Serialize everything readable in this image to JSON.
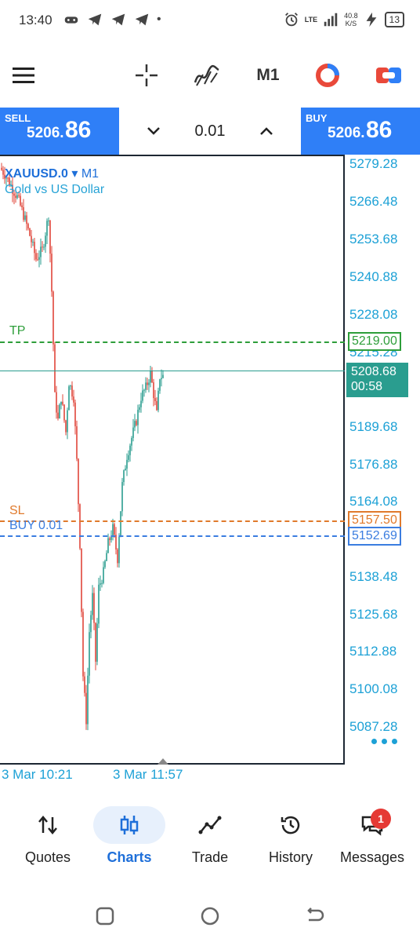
{
  "status_bar": {
    "time": "13:40",
    "dot": "•",
    "network": "LTE",
    "net_speed_value": "40.8",
    "net_speed_unit": "K/S",
    "battery": "13"
  },
  "toolbar": {
    "menu_icon": "hamburger-menu-icon",
    "crosshair_icon": "crosshair-icon",
    "indicators_icon": "indicators-icon",
    "timeframe": "M1",
    "objects_icon": "objects-icon",
    "trade_toggle_icon": "one-click-trading-icon"
  },
  "trade_bar": {
    "sell_label": "SELL",
    "sell_price_small": "5206.",
    "sell_price_big": "86",
    "volume": "0.01",
    "buy_label": "BUY",
    "buy_price_small": "5206.",
    "buy_price_big": "86",
    "colors": {
      "button_bg": "#2f7ff7"
    }
  },
  "chart": {
    "symbol": "XAUUSD.0",
    "timeframe": "M1",
    "symbol_arrow": "▾",
    "description": "Gold vs US Dollar",
    "price_axis": [
      "5279.28",
      "5266.48",
      "5253.68",
      "5240.88",
      "5228.08",
      "5215.28",
      "5189.68",
      "5176.88",
      "5164.08",
      "5138.48",
      "5125.68",
      "5112.88",
      "5100.08",
      "5087.28"
    ],
    "tp": {
      "label": "TP",
      "price": "5219.00",
      "color": "#2e9e3a"
    },
    "bid": {
      "price": "5208.68",
      "countdown": "00:58",
      "color": "#2a9d8f"
    },
    "sl": {
      "label": "SL",
      "price": "5157.50",
      "color": "#e07a2c"
    },
    "position": {
      "label": "BUY 0.01",
      "price": "5152.69",
      "color": "#3b7de0"
    },
    "time_labels": [
      "3 Mar 10:21",
      "3 Mar 11:57"
    ],
    "colors": {
      "bull": "#2a9d8f",
      "bear": "#e0463a",
      "axis_text": "#1da1d6"
    }
  },
  "bottom_nav": {
    "items": [
      {
        "label": "Quotes",
        "icon": "quotes-arrows-icon",
        "active": false
      },
      {
        "label": "Charts",
        "icon": "charts-candles-icon",
        "active": true
      },
      {
        "label": "Trade",
        "icon": "trade-line-icon",
        "active": false
      },
      {
        "label": "History",
        "icon": "history-clock-icon",
        "active": false
      },
      {
        "label": "Messages",
        "icon": "messages-icon",
        "active": false,
        "badge": "1"
      }
    ]
  },
  "system_nav": {
    "recents_icon": "recents-icon",
    "home_icon": "home-icon",
    "back_icon": "back-icon"
  }
}
